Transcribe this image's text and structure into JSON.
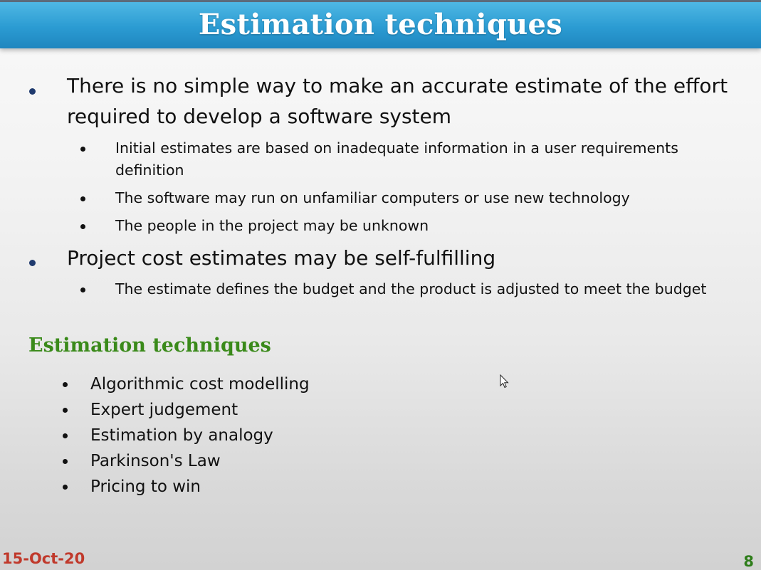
{
  "slide": {
    "title": "Estimation techniques",
    "bullets": [
      {
        "text": "There is no simple way to make an accurate estimate of the effort required to develop a software system",
        "sub": [
          "Initial estimates are based on inadequate information in a user requirements definition",
          "The software may run on unfamiliar computers or use new technology",
          "The people in the project may be unknown"
        ]
      },
      {
        "text": "Project cost estimates may be self-fulfilling",
        "sub": [
          "The estimate defines the budget and the product is adjusted to meet the budget"
        ]
      }
    ],
    "section_heading": "Estimation techniques",
    "techniques": [
      "Algorithmic cost modelling",
      "Expert judgement",
      "Estimation by analogy",
      "Parkinson's Law",
      "Pricing to win"
    ],
    "footer": {
      "date": "15-Oct-20",
      "page": "8"
    }
  },
  "colors": {
    "title_bar": "#2b9bd2",
    "heading_green": "#3a8a1a",
    "date_red": "#c0392b",
    "page_green": "#2e7d1a"
  },
  "icons": {
    "cursor": "mouse-pointer-icon"
  }
}
